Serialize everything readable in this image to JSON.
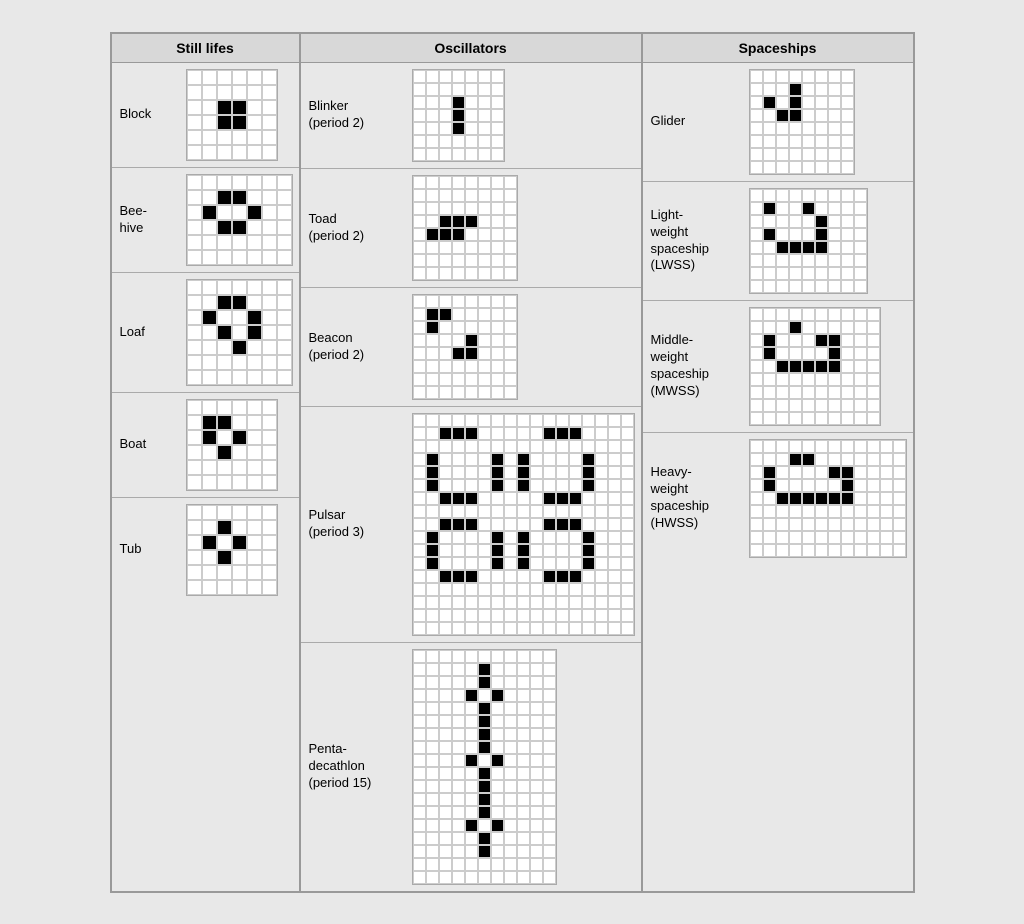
{
  "sections": {
    "still_lifes": {
      "title": "Still lifes",
      "patterns": [
        {
          "name": "Block",
          "cols": 6,
          "rows": 6,
          "alive": [
            [
              2,
              2
            ],
            [
              3,
              2
            ],
            [
              2,
              3
            ],
            [
              3,
              3
            ]
          ]
        },
        {
          "name": "Bee-\nhive",
          "cols": 7,
          "rows": 6,
          "alive": [
            [
              2,
              1
            ],
            [
              3,
              1
            ],
            [
              1,
              2
            ],
            [
              4,
              2
            ],
            [
              2,
              3
            ],
            [
              3,
              3
            ]
          ]
        },
        {
          "name": "Loaf",
          "cols": 7,
          "rows": 7,
          "alive": [
            [
              2,
              1
            ],
            [
              3,
              1
            ],
            [
              1,
              2
            ],
            [
              4,
              2
            ],
            [
              2,
              3
            ],
            [
              4,
              3
            ],
            [
              3,
              4
            ]
          ]
        },
        {
          "name": "Boat",
          "cols": 6,
          "rows": 6,
          "alive": [
            [
              1,
              1
            ],
            [
              2,
              1
            ],
            [
              1,
              2
            ],
            [
              3,
              2
            ],
            [
              2,
              3
            ]
          ]
        },
        {
          "name": "Tub",
          "cols": 6,
          "rows": 6,
          "alive": [
            [
              2,
              1
            ],
            [
              1,
              2
            ],
            [
              3,
              2
            ],
            [
              2,
              3
            ]
          ]
        }
      ]
    },
    "oscillators": {
      "title": "Oscillators",
      "patterns": [
        {
          "name": "Blinker\n(period 2)",
          "cols": 7,
          "rows": 7,
          "alive": [
            [
              3,
              2
            ],
            [
              3,
              3
            ],
            [
              3,
              4
            ]
          ]
        },
        {
          "name": "Toad\n(period 2)",
          "cols": 8,
          "rows": 8,
          "alive": [
            [
              2,
              3
            ],
            [
              3,
              3
            ],
            [
              4,
              3
            ],
            [
              1,
              4
            ],
            [
              2,
              4
            ],
            [
              3,
              4
            ]
          ]
        },
        {
          "name": "Beacon\n(period 2)",
          "cols": 8,
          "rows": 8,
          "alive": [
            [
              1,
              1
            ],
            [
              2,
              1
            ],
            [
              1,
              2
            ],
            [
              4,
              3
            ],
            [
              3,
              4
            ],
            [
              4,
              4
            ]
          ]
        },
        {
          "name": "Pulsar\n(period 3)",
          "cols": 17,
          "rows": 17,
          "alive": [
            [
              2,
              1
            ],
            [
              3,
              1
            ],
            [
              4,
              1
            ],
            [
              10,
              1
            ],
            [
              11,
              1
            ],
            [
              12,
              1
            ],
            [
              1,
              3
            ],
            [
              6,
              3
            ],
            [
              8,
              3
            ],
            [
              13,
              3
            ],
            [
              1,
              4
            ],
            [
              6,
              4
            ],
            [
              8,
              4
            ],
            [
              13,
              4
            ],
            [
              1,
              5
            ],
            [
              6,
              5
            ],
            [
              8,
              5
            ],
            [
              13,
              5
            ],
            [
              2,
              6
            ],
            [
              3,
              6
            ],
            [
              4,
              6
            ],
            [
              10,
              6
            ],
            [
              11,
              6
            ],
            [
              12,
              6
            ],
            [
              2,
              8
            ],
            [
              3,
              8
            ],
            [
              4,
              8
            ],
            [
              10,
              8
            ],
            [
              11,
              8
            ],
            [
              12,
              8
            ],
            [
              1,
              9
            ],
            [
              6,
              9
            ],
            [
              8,
              9
            ],
            [
              13,
              9
            ],
            [
              1,
              10
            ],
            [
              6,
              10
            ],
            [
              8,
              10
            ],
            [
              13,
              10
            ],
            [
              1,
              11
            ],
            [
              6,
              11
            ],
            [
              8,
              11
            ],
            [
              13,
              11
            ],
            [
              2,
              12
            ],
            [
              3,
              12
            ],
            [
              4,
              12
            ],
            [
              10,
              12
            ],
            [
              11,
              12
            ],
            [
              12,
              12
            ]
          ]
        },
        {
          "name": "Penta-\ndecathlon\n(period 15)",
          "cols": 11,
          "rows": 18,
          "alive": [
            [
              5,
              1
            ],
            [
              5,
              2
            ],
            [
              4,
              3
            ],
            [
              6,
              3
            ],
            [
              5,
              4
            ],
            [
              5,
              5
            ],
            [
              5,
              6
            ],
            [
              5,
              7
            ],
            [
              4,
              8
            ],
            [
              6,
              8
            ],
            [
              5,
              9
            ],
            [
              5,
              10
            ],
            [
              5,
              11
            ],
            [
              5,
              12
            ],
            [
              4,
              13
            ],
            [
              6,
              13
            ],
            [
              5,
              14
            ],
            [
              5,
              15
            ]
          ]
        }
      ]
    },
    "spaceships": {
      "title": "Spaceships",
      "patterns": [
        {
          "name": "Glider",
          "cols": 8,
          "rows": 8,
          "alive": [
            [
              3,
              1
            ],
            [
              1,
              2
            ],
            [
              3,
              2
            ],
            [
              2,
              3
            ],
            [
              3,
              3
            ]
          ]
        },
        {
          "name": "Light-\nweight\nspaceship\n(LWSS)",
          "cols": 9,
          "rows": 8,
          "alive": [
            [
              1,
              1
            ],
            [
              4,
              1
            ],
            [
              5,
              2
            ],
            [
              1,
              3
            ],
            [
              5,
              3
            ],
            [
              2,
              4
            ],
            [
              3,
              4
            ],
            [
              4,
              4
            ],
            [
              5,
              4
            ]
          ]
        },
        {
          "name": "Middle-\nweight\nspaceship\n(MWSS)",
          "cols": 10,
          "rows": 9,
          "alive": [
            [
              3,
              1
            ],
            [
              1,
              2
            ],
            [
              5,
              2
            ],
            [
              6,
              2
            ],
            [
              1,
              3
            ],
            [
              6,
              3
            ],
            [
              2,
              4
            ],
            [
              3,
              4
            ],
            [
              4,
              4
            ],
            [
              5,
              4
            ],
            [
              6,
              4
            ]
          ]
        },
        {
          "name": "Heavy-\nweight\nspaceship\n(HWSS)",
          "cols": 12,
          "rows": 9,
          "alive": [
            [
              3,
              1
            ],
            [
              4,
              1
            ],
            [
              1,
              2
            ],
            [
              6,
              2
            ],
            [
              7,
              2
            ],
            [
              1,
              3
            ],
            [
              7,
              3
            ],
            [
              2,
              4
            ],
            [
              3,
              4
            ],
            [
              4,
              4
            ],
            [
              5,
              4
            ],
            [
              6,
              4
            ],
            [
              7,
              4
            ]
          ]
        }
      ]
    }
  }
}
